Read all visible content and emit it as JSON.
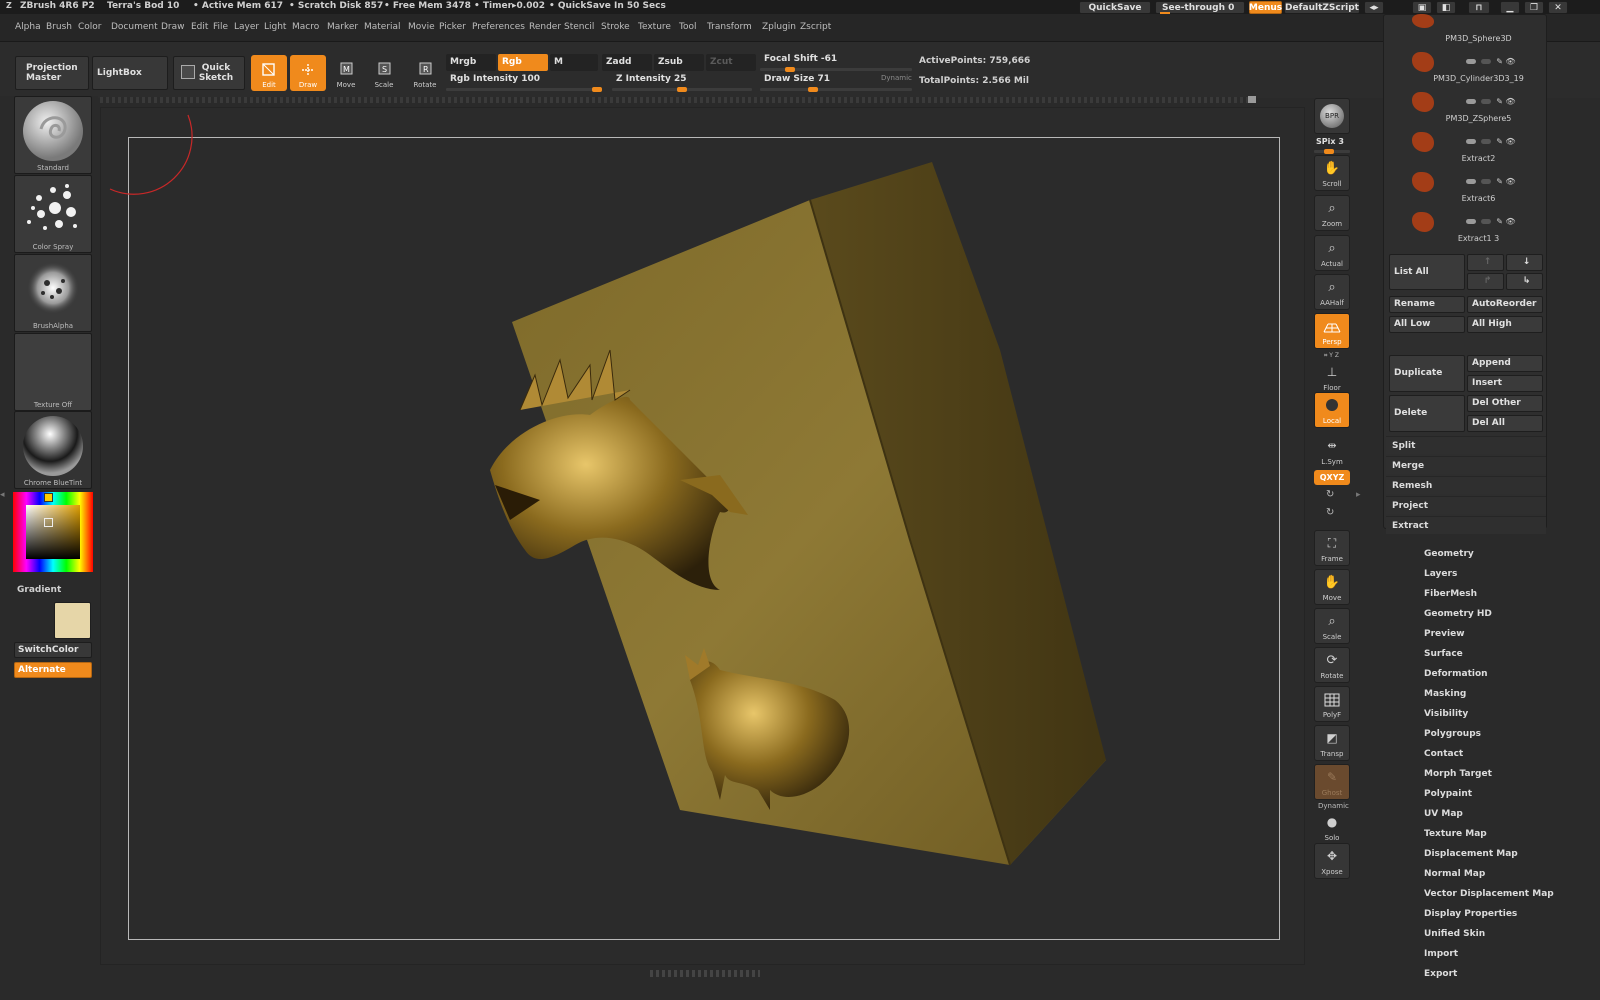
{
  "titlebar": {
    "app_name": "ZBrush 4R6 P2",
    "doc_name": "Terra's Bod 10",
    "active_mem": "• Active Mem 617",
    "scratch_disk": "• Scratch Disk 857",
    "free_mem": "• Free Mem 3478",
    "timer": "• Timer▸0.002",
    "quicksave_msg": "• QuickSave In 50 Secs",
    "quicksave_btn": "QuickSave",
    "seethrough": "See-through  0",
    "menus_btn": "Menus",
    "script_name": "DefaultZScript"
  },
  "menubar": {
    "items": [
      "Alpha",
      "Brush",
      "Color",
      "Document",
      "Draw",
      "Edit",
      "File",
      "Layer",
      "Light",
      "Macro",
      "Marker",
      "Material",
      "Movie",
      "Picker",
      "Preferences",
      "Render",
      "Stencil",
      "Stroke",
      "Texture",
      "Tool",
      "Transform",
      "Zplugin",
      "Zscript"
    ]
  },
  "shelf": {
    "projection_master": "Projection Master",
    "lightbox": "LightBox",
    "quick_sketch": "Quick Sketch",
    "tools": {
      "edit": "Edit",
      "draw": "Draw",
      "move": "Move",
      "scale": "Scale",
      "rotate": "Rotate"
    },
    "mrgb": "Mrgb",
    "rgb": "Rgb",
    "m": "M",
    "zadd": "Zadd",
    "zsub": "Zsub",
    "zcut": "Zcut",
    "rgb_intensity": "Rgb Intensity 100",
    "z_intensity": "Z Intensity 25",
    "focal_shift": "Focal Shift -61",
    "draw_size": "Draw Size 71",
    "dynamic": "Dynamic",
    "active_points": "ActivePoints: 759,666",
    "total_points": "TotalPoints: 2.566 Mil",
    "rgb_intensity_value": 100,
    "z_intensity_value": 25,
    "focal_shift_value": -61,
    "draw_size_value": 71
  },
  "left": {
    "brush": "Standard",
    "stroke": "Color Spray",
    "alpha": "BrushAlpha",
    "texture": "Texture Off",
    "material": "Chrome BlueTint",
    "gradient": "Gradient",
    "switchcolor": "SwitchColor",
    "alternate": "Alternate",
    "secondary_color": "#e6d6a8"
  },
  "right_shelf": {
    "bpr": "BPR",
    "spix": "SPix 3",
    "scroll": "Scroll",
    "zoom": "Zoom",
    "actual": "Actual",
    "aahalf": "AAHalf",
    "persp": "Persp",
    "xyz_small": "⌗ Y Z",
    "floor": "Floor",
    "local": "Local",
    "lsym": "L.Sym",
    "qxyz": "QXYZ",
    "frame": "Frame",
    "move": "Move",
    "scale": "Scale",
    "rotate": "Rotate",
    "polyf": "PolyF",
    "transp": "Transp",
    "ghost": "Ghost",
    "dynamic": "Dynamic",
    "solo": "Solo",
    "xpose": "Xpose"
  },
  "subtool": {
    "items": [
      {
        "name": "PM3D_Sphere3D"
      },
      {
        "name": "PM3D_Cylinder3D3_19"
      },
      {
        "name": "PM3D_ZSphere5"
      },
      {
        "name": "Extract2"
      },
      {
        "name": "Extract6"
      },
      {
        "name": "Extract1 3"
      }
    ],
    "list_all": "List  All",
    "rename": "Rename",
    "autoreorder": "AutoReorder",
    "all_low": "All Low",
    "all_high": "All High",
    "duplicate": "Duplicate",
    "append": "Append",
    "insert": "Insert",
    "delete": "Delete",
    "del_other": "Del Other",
    "del_all": "Del All",
    "split": "Split",
    "merge": "Merge",
    "remesh": "Remesh",
    "project": "Project",
    "extract": "Extract"
  },
  "tool_sections": [
    "Geometry",
    "Layers",
    "FiberMesh",
    "Geometry HD",
    "Preview",
    "Surface",
    "Deformation",
    "Masking",
    "Visibility",
    "Polygroups",
    "Contact",
    "Morph Target",
    "Polypaint",
    "UV Map",
    "Texture Map",
    "Displacement Map",
    "Normal Map",
    "Vector Displacement Map",
    "Display Properties",
    "Unified Skin",
    "Import",
    "Export"
  ],
  "colors": {
    "accent": "#f08a1c",
    "model": "#8a7430"
  }
}
